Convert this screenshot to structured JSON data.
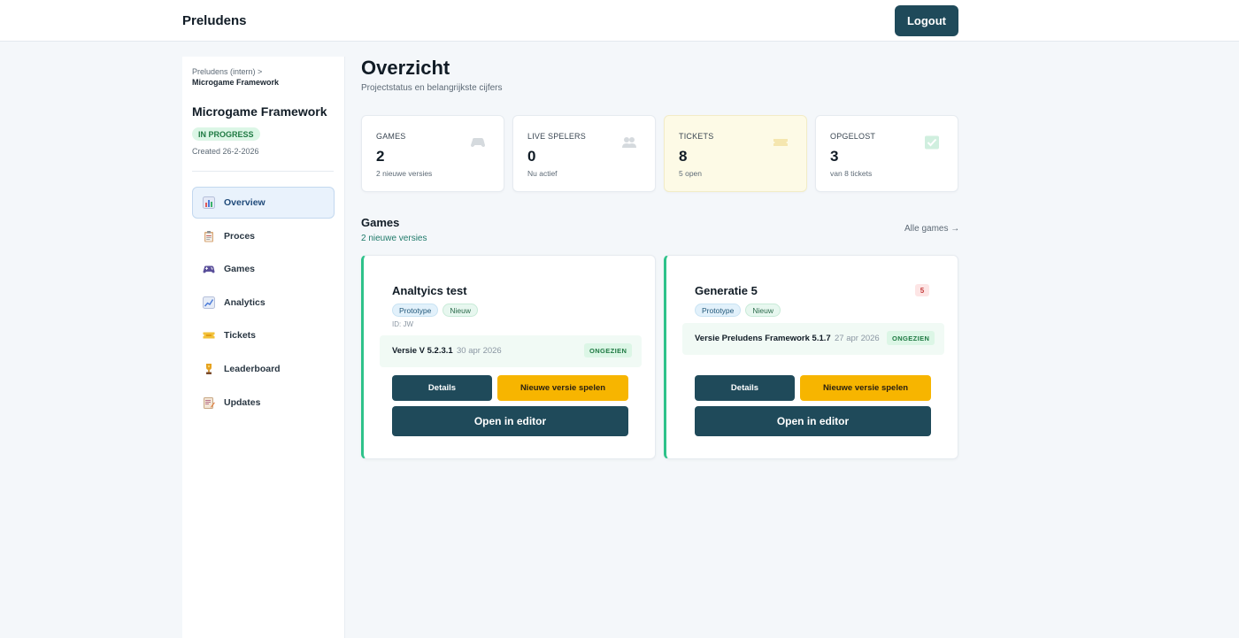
{
  "header": {
    "brand": "Preludens",
    "logout_label": "Logout"
  },
  "sidebar": {
    "breadcrumb": {
      "parent": "Preludens (intern) >",
      "current": "Microgame Framework"
    },
    "project_title": "Microgame Framework",
    "status": "IN PROGRESS",
    "created": "Created 26-2-2026",
    "items": [
      {
        "label": "Overview",
        "icon": "bar-chart-icon",
        "active": true
      },
      {
        "label": "Proces",
        "icon": "clipboard-icon"
      },
      {
        "label": "Games",
        "icon": "gamepad-icon"
      },
      {
        "label": "Analytics",
        "icon": "line-chart-icon"
      },
      {
        "label": "Tickets",
        "icon": "ticket-icon"
      },
      {
        "label": "Leaderboard",
        "icon": "trophy-icon"
      },
      {
        "label": "Updates",
        "icon": "memo-icon"
      }
    ]
  },
  "main": {
    "title": "Overzicht",
    "subtitle": "Projectstatus en belangrijkste cijfers",
    "stats": [
      {
        "label": "GAMES",
        "value": "2",
        "sub": "2 nieuwe versies",
        "icon": "gamepad-icon"
      },
      {
        "label": "LIVE SPELERS",
        "value": "0",
        "sub": "Nu actief",
        "icon": "users-icon"
      },
      {
        "label": "TICKETS",
        "value": "8",
        "sub": "5 open",
        "icon": "ticket-icon"
      },
      {
        "label": "OPGELOST",
        "value": "3",
        "sub": "van 8 tickets",
        "icon": "check-icon"
      }
    ],
    "games_section": {
      "title": "Games",
      "subtitle": "2 nieuwe versies",
      "all_link": "Alle games →"
    },
    "games": [
      {
        "title": "Analtyics test",
        "tags": [
          "Prototype",
          "Nieuw"
        ],
        "id_text": "ID: JW",
        "version": "Versie V 5.2.3.1",
        "date": "30 apr 2026",
        "badge": "ONGEZIEN",
        "details_label": "Details",
        "play_label": "Nieuwe versie spelen",
        "editor_label": "Open in editor"
      },
      {
        "title": "Generatie 5",
        "count": "5",
        "tags": [
          "Prototype",
          "Nieuw"
        ],
        "version": "Versie Preludens Framework 5.1.7",
        "date": "27 apr 2026",
        "badge": "ONGEZIEN",
        "details_label": "Details",
        "play_label": "Nieuwe versie spelen",
        "editor_label": "Open in editor"
      }
    ]
  },
  "colors": {
    "primary": "#1f4a5a",
    "accent_yellow": "#f7b500",
    "success_green": "#2ec28a",
    "background": "#f4f7fa"
  }
}
